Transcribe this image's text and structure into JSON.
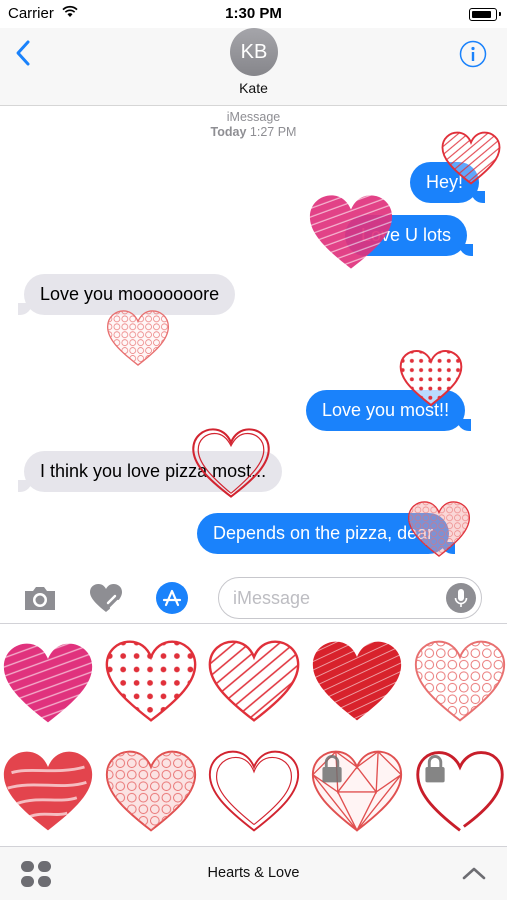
{
  "status_bar": {
    "carrier": "Carrier",
    "time": "1:30 PM"
  },
  "header": {
    "avatar_initials": "KB",
    "contact_name": "Kate"
  },
  "conversation": {
    "service_label": "iMessage",
    "timestamp_day": "Today",
    "timestamp_time": "1:27 PM",
    "messages": [
      {
        "direction": "outgoing",
        "text": "Hey!"
      },
      {
        "direction": "outgoing",
        "text": "Love U lots"
      },
      {
        "direction": "incoming",
        "text": "Love you mooooooore"
      },
      {
        "direction": "outgoing",
        "text": "Love you most!!"
      },
      {
        "direction": "incoming",
        "text": "I think you love pizza most..."
      },
      {
        "direction": "outgoing",
        "text": "Depends on the pizza, dear"
      }
    ]
  },
  "input": {
    "placeholder": "iMessage"
  },
  "sticker_pack": {
    "name": "Hearts & Love",
    "stickers": [
      {
        "icon": "pink-scribble-heart-icon",
        "locked": false
      },
      {
        "icon": "polka-dot-heart-icon",
        "locked": false
      },
      {
        "icon": "striped-heart-icon",
        "locked": false
      },
      {
        "icon": "red-scribble-heart-icon",
        "locked": false
      },
      {
        "icon": "lace-heart-icon",
        "locked": false
      },
      {
        "icon": "red-brush-heart-icon",
        "locked": false
      },
      {
        "icon": "crayon-heart-icon",
        "locked": false
      },
      {
        "icon": "outline-heart-icon",
        "locked": false
      },
      {
        "icon": "geometric-heart-icon",
        "locked": true
      },
      {
        "icon": "open-heart-icon",
        "locked": true
      }
    ]
  },
  "colors": {
    "accent": "#1a82fb",
    "incoming_bubble": "#e6e5eb",
    "heart_red": "#e0303a",
    "heart_pink": "#e0327d"
  }
}
